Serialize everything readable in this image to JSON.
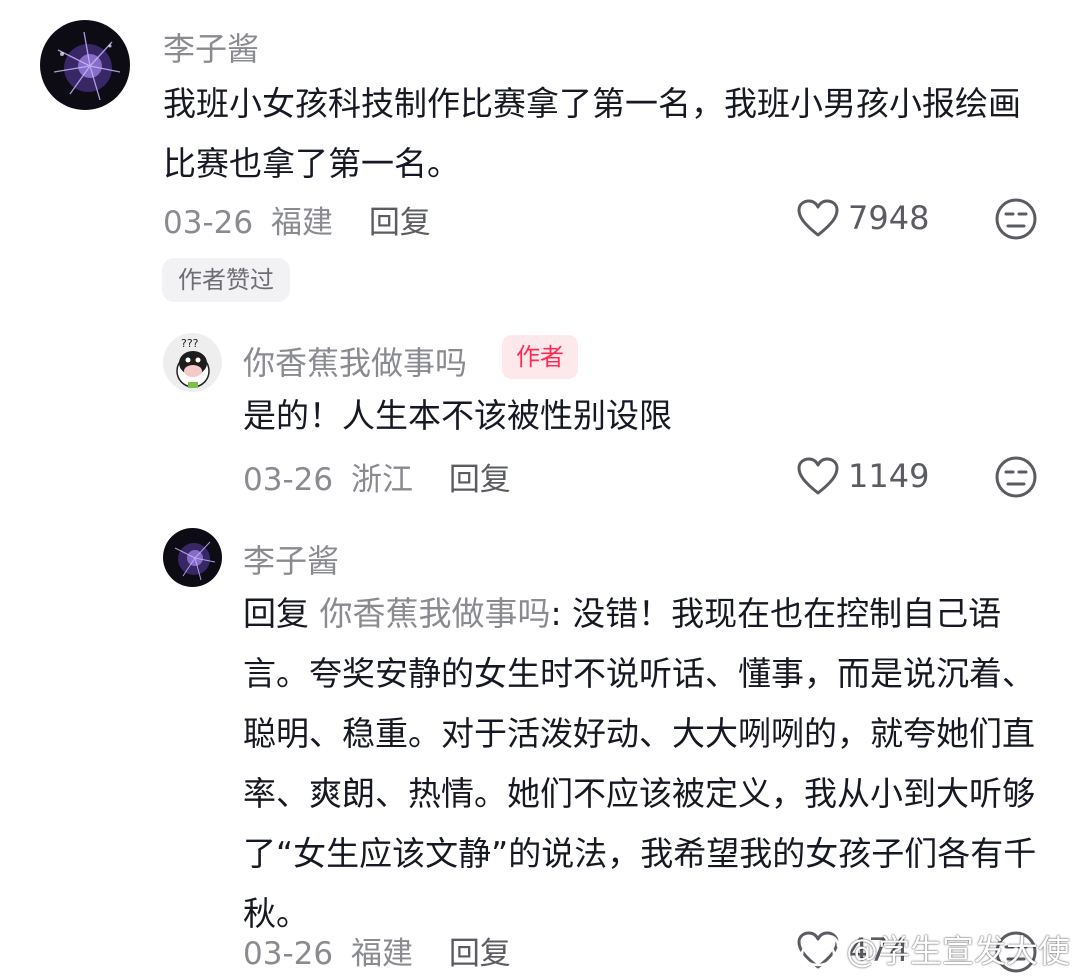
{
  "comments": [
    {
      "username": "李子酱",
      "text": "我班小女孩科技制作比赛拿了第一名，我班小男孩小报绘画比赛也拿了第一名。",
      "date": "03-26",
      "location": "福建",
      "reply_label": "回复",
      "likes": "7948",
      "author_liked_label": "作者赞过"
    }
  ],
  "replies": [
    {
      "username": "你香蕉我做事吗",
      "author_tag": "作者",
      "text": "是的！人生本不该被性别设限",
      "date": "03-26",
      "location": "浙江",
      "reply_label": "回复",
      "likes": "1149"
    },
    {
      "username": "李子酱",
      "reply_prefix": "回复",
      "reply_target": "你香蕉我做事吗",
      "text": ": 没错！我现在也在控制自己语言。夸奖安静的女生时不说听话、懂事，而是说沉着、聪明、稳重。对于活泼好动、大大咧咧的，就夸她们直率、爽朗、热情。她们不应该被定义，我从小到大听够了“女生应该文静”的说法，我希望我的女孩子们各有千秋。",
      "date": "03-26",
      "location": "福建",
      "reply_label": "回复",
      "likes": "474"
    }
  ],
  "watermark": "@学生宣发大使",
  "icons": {
    "like": "heart-outline-icon",
    "dislike": "meh-face-icon",
    "watermark": "weibo-logo-icon"
  }
}
